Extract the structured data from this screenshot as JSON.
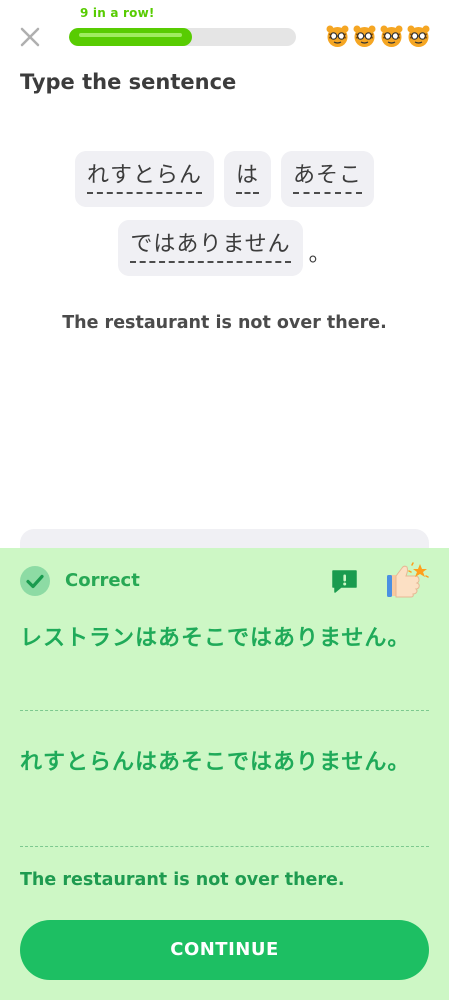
{
  "header": {
    "close_icon": "close-icon",
    "streak_label": "9 in a row!",
    "progress": 0.54,
    "hearts": [
      "tiger-face-icon",
      "tiger-face-icon",
      "tiger-face-icon",
      "tiger-face-icon"
    ]
  },
  "challenge": {
    "instruction": "Type the sentence",
    "words": [
      {
        "text": "れすとらん"
      },
      {
        "text": "は"
      },
      {
        "text": "あそこ"
      },
      {
        "text": "ではありません"
      }
    ],
    "period": "。",
    "translation": "The restaurant is not over there."
  },
  "feedback": {
    "status_label": "Correct",
    "status_icon": "check-circle-icon",
    "report_icon": "report-flag-icon",
    "mascot_icon": "thumbs-up-star-icon",
    "answer_katakana": "レストランはあそこではありません。",
    "answer_hiragana": "れすとらんはあそこではありません。",
    "meaning": "The restaurant is not over there.",
    "continue_label": "CONTINUE"
  },
  "colors": {
    "progress": "#58cc02",
    "feedback_bg": "#cdf7c5",
    "correct_text": "#27a855",
    "button": "#1dbf63"
  }
}
